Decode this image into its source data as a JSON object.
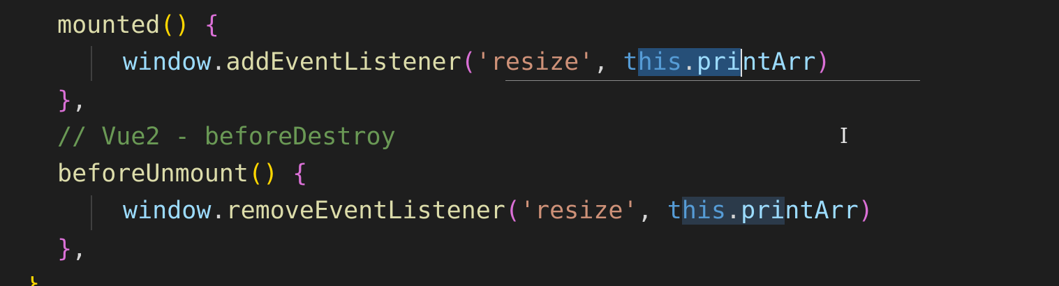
{
  "code": {
    "line1": {
      "method": "mounted",
      "parens": "()",
      "brace": "{"
    },
    "line2": {
      "obj": "window",
      "dot1": ".",
      "call": "addEventListener",
      "open": "(",
      "str": "'resize'",
      "comma": ", ",
      "this_a": "t",
      "this_b": "his",
      "dot2": ".",
      "prop_a": "pri",
      "prop_b": "ntArr",
      "close": ")"
    },
    "line3": {
      "brace": "}",
      "comma": ","
    },
    "line4": {
      "comment": "// Vue2 - beforeDestroy"
    },
    "line5": {
      "method": "beforeUnmount",
      "parens": "()",
      "brace": "{"
    },
    "line6": {
      "obj": "window",
      "dot1": ".",
      "call": "removeEventListener",
      "open": "(",
      "str": "'resize'",
      "comma": ", ",
      "this_a": "t",
      "this_b": "his",
      "dot2": ".",
      "prop_a": "pri",
      "prop_b": "ntArr",
      "close": ")"
    },
    "line7": {
      "brace": "}",
      "comma": ","
    },
    "line8": {
      "brace": "}"
    }
  },
  "pointer": {
    "icon": "i-beam-cursor-icon",
    "glyph": "I"
  },
  "colors": {
    "background": "#1e1e1e",
    "function": "#dcdcaa",
    "variable": "#9cdcfe",
    "string": "#ce9178",
    "comment": "#6a9955",
    "selection": "#264f78",
    "bracket_gold": "#ffd700",
    "bracket_purple": "#da70d6"
  }
}
